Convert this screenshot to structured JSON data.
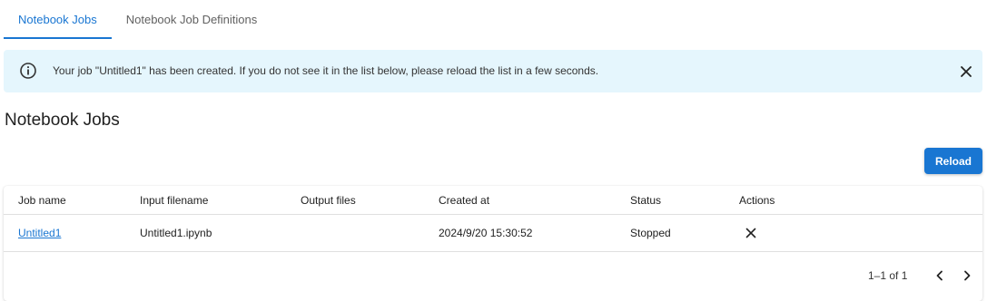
{
  "tabs": [
    {
      "label": "Notebook Jobs",
      "active": true
    },
    {
      "label": "Notebook Job Definitions",
      "active": false
    }
  ],
  "alert": {
    "icon": "info-icon",
    "message": "Your job \"Untitled1\" has been created. If you do not see it in the list below, please reload the list in a few seconds.",
    "close_icon": "close-icon",
    "background": "#e5f6fd"
  },
  "page_title": "Notebook Jobs",
  "reload_label": "Reload",
  "colors": {
    "accent": "#1976d2"
  },
  "table": {
    "columns": [
      "Job name",
      "Input filename",
      "Output files",
      "Created at",
      "Status",
      "Actions"
    ],
    "rows": [
      {
        "job_name": "Untitled1",
        "input_filename": "Untitled1.ipynb",
        "output_files": "",
        "created_at": "2024/9/20 15:30:52",
        "status": "Stopped",
        "action_icon": "close-icon"
      }
    ]
  },
  "pagination": {
    "range_text": "1–1 of 1",
    "prev_icon": "chevron-left-icon",
    "next_icon": "chevron-right-icon"
  }
}
